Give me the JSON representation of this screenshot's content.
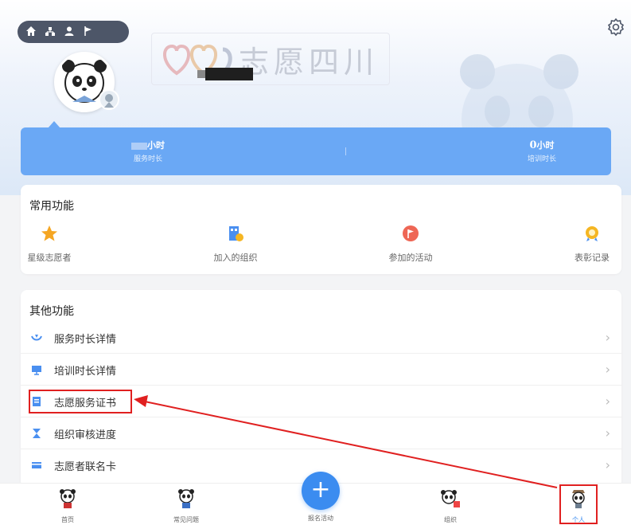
{
  "header": {
    "nav_icons": [
      "home-icon",
      "org-icon",
      "user-icon",
      "flag-icon"
    ],
    "logo_text": "志愿四川",
    "settings_icon": "gear-icon"
  },
  "stats": {
    "service": {
      "unit": "小时",
      "label": "服务时长"
    },
    "training": {
      "value": "0",
      "unit": "小时",
      "label": "培训时长"
    }
  },
  "common": {
    "title": "常用功能",
    "items": [
      {
        "label": "星级志愿者",
        "icon": "star-icon",
        "color": "#f5a623"
      },
      {
        "label": "加入的组织",
        "icon": "building-icon",
        "color": "#4a8ff0"
      },
      {
        "label": "参加的活动",
        "icon": "flag-icon",
        "color": "#ee6655"
      },
      {
        "label": "表彰记录",
        "icon": "medal-icon",
        "color": "#f5b623"
      }
    ]
  },
  "other": {
    "title": "其他功能",
    "items": [
      {
        "label": "服务时长详情",
        "icon": "hands-icon"
      },
      {
        "label": "培训时长详情",
        "icon": "screen-icon"
      },
      {
        "label": "志愿服务证书",
        "icon": "certificate-icon"
      },
      {
        "label": "组织审核进度",
        "icon": "hourglass-icon"
      },
      {
        "label": "志愿者联名卡",
        "icon": "card-icon"
      }
    ]
  },
  "tabbar": {
    "items": [
      {
        "label": "首页",
        "icon": "panda-home-icon"
      },
      {
        "label": "常见问题",
        "icon": "panda-faq-icon"
      },
      {
        "label": "报名活动",
        "icon": "plus-icon"
      },
      {
        "label": "组织",
        "icon": "panda-org-icon"
      },
      {
        "label": "个人",
        "icon": "panda-personal-icon"
      }
    ],
    "active_color": "#3b8cf0"
  }
}
